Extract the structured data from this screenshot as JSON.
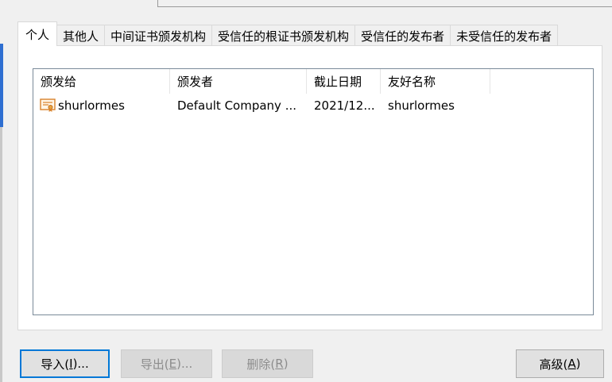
{
  "tabs": [
    {
      "label": "个人",
      "active": true
    },
    {
      "label": "其他人"
    },
    {
      "label": "中间证书颁发机构"
    },
    {
      "label": "受信任的根证书颁发机构"
    },
    {
      "label": "受信任的发布者"
    },
    {
      "label": "未受信任的发布者"
    }
  ],
  "list": {
    "columns": [
      "颁发给",
      "颁发者",
      "截止日期",
      "友好名称"
    ],
    "rows": [
      {
        "icon": "certificate-icon",
        "issued_to": "shurlormes",
        "issued_by": "Default Company ...",
        "expiration": "2021/12...",
        "friendly_name": "shurlormes"
      }
    ]
  },
  "buttons": {
    "import": {
      "label": "导入(I)...",
      "mnemonic": "I"
    },
    "export": {
      "label": "导出(E)...",
      "mnemonic": "E",
      "disabled": true
    },
    "remove": {
      "label": "删除(R)",
      "mnemonic": "R",
      "disabled": true
    },
    "advanced": {
      "label": "高级(A)",
      "mnemonic": "A"
    }
  },
  "colors": {
    "accent": "#0078d7",
    "list_border": "#7a8a99",
    "certificate_icon": "#d9822b"
  }
}
